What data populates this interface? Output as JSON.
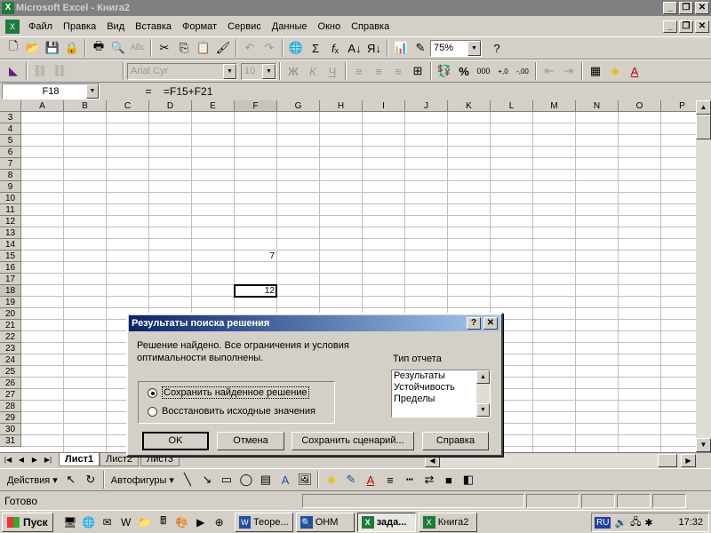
{
  "window": {
    "title": "Microsoft Excel - Книга2",
    "app_icon": "X"
  },
  "menu": [
    "Файл",
    "Правка",
    "Вид",
    "Вставка",
    "Формат",
    "Сервис",
    "Данные",
    "Окно",
    "Справка"
  ],
  "menu_hotkeys": [
    "Ф",
    "П",
    "В",
    "т",
    "о",
    "С",
    "Д",
    "О",
    "С"
  ],
  "standard_toolbar": {
    "zoom": "75%"
  },
  "format_toolbar": {
    "font": "Arial Cyr",
    "size": "10",
    "bold": "Ж",
    "italic": "К",
    "underline": "Ч",
    "percent": "%",
    "thousands": "000"
  },
  "formula_bar": {
    "name_box": "F18",
    "equals": "=",
    "formula": "=F15+F21"
  },
  "grid": {
    "columns": [
      "A",
      "B",
      "C",
      "D",
      "E",
      "F",
      "G",
      "H",
      "I",
      "J",
      "K",
      "L",
      "M",
      "N",
      "O",
      "P"
    ],
    "rows": [
      "3",
      "4",
      "5",
      "6",
      "7",
      "8",
      "9",
      "10",
      "11",
      "12",
      "13",
      "14",
      "15",
      "16",
      "17",
      "18",
      "19",
      "20",
      "21",
      "22",
      "23",
      "24",
      "25",
      "26",
      "27",
      "28",
      "29",
      "30",
      "31"
    ],
    "cells": {
      "F15": "7",
      "F18": "12"
    },
    "selected": "F18"
  },
  "sheets": [
    "Лист1",
    "Лист2",
    "Лист3"
  ],
  "drawing_toolbar": {
    "actions": "Действия ▾",
    "autoshapes": "Автофигуры ▾"
  },
  "status": {
    "text": "Готово"
  },
  "taskbar": {
    "start": "Пуск",
    "buttons": [
      "Теоре...",
      "ОНМ",
      "зада...",
      "Книга2"
    ],
    "lang": "RU",
    "clock": "17:32"
  },
  "dialog": {
    "title": "Результаты поиска решения",
    "help_btn": "?",
    "close_btn": "✕",
    "message_line1": "Решение найдено. Все ограничения и условия",
    "message_line2": "оптимальности выполнены.",
    "radio_keep": "Сохранить найденное решение",
    "radio_restore": "Восстановить исходные значения",
    "report_type_label": "Тип отчета",
    "reports": [
      "Результаты",
      "Устойчивость",
      "Пределы"
    ],
    "buttons": {
      "ok": "OK",
      "cancel": "Отмена",
      "save_scenario": "Сохранить сценарий...",
      "help": "Справка"
    }
  }
}
